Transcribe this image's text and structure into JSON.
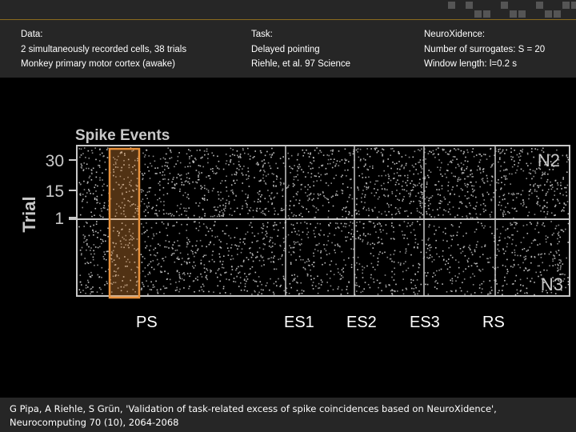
{
  "header": {
    "data": {
      "heading": "Data:",
      "line1": "2 simultaneously recorded cells, 38 trials",
      "line2": "Monkey primary motor cortex (awake)"
    },
    "task": {
      "heading": "Task:",
      "line1": "Delayed pointing",
      "line2": "Riehle, et al. 97 Science"
    },
    "neuroxidence": {
      "heading": "NeuroXidence:",
      "line1": "Number of surrogates: S = 20",
      "line2": "Window length: l=0.2 s"
    }
  },
  "figure": {
    "title": "Spike Events",
    "ylabel": "Trial",
    "yticks": [
      "30",
      "15",
      "1"
    ],
    "neuron_top": "N2",
    "neuron_bottom": "N3",
    "highlight_color": "#e8903a",
    "epochs": [
      "PS",
      "ES1",
      "ES2",
      "ES3",
      "RS"
    ]
  },
  "footer": {
    "citation": "G Pipa, A Riehle, S Grün, 'Validation of task-related excess of spike coincidences based on NeuroXidence', Neurocomputing 70 (10), 2064-2068"
  }
}
